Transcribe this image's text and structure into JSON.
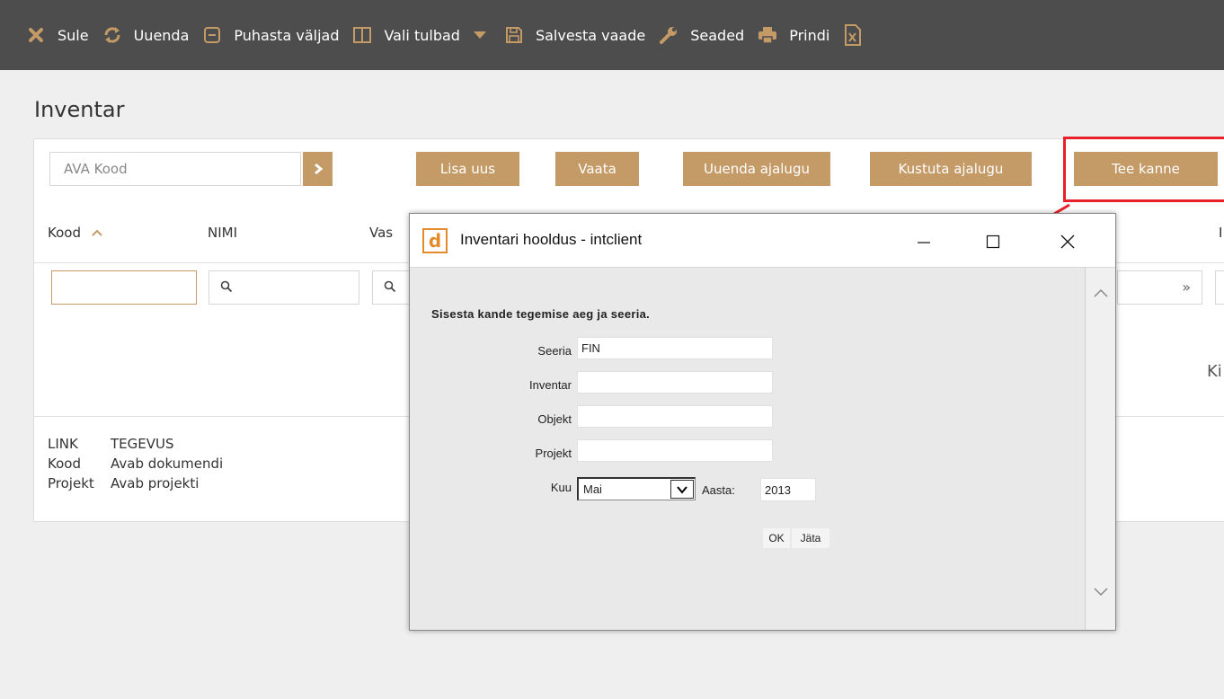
{
  "toolbar": {
    "items": [
      {
        "label": "Sule",
        "icon": "close-icon"
      },
      {
        "label": "Uuenda",
        "icon": "refresh-icon"
      },
      {
        "label": "Puhasta väljad",
        "icon": "clear-fields-icon"
      },
      {
        "label": "Vali tulbad",
        "icon": "columns-icon"
      },
      {
        "label": "Salvesta vaade",
        "icon": "save-icon"
      },
      {
        "label": "Seaded",
        "icon": "wrench-icon"
      },
      {
        "label": "Prindi",
        "icon": "print-icon"
      }
    ],
    "excel_icon": "excel-icon"
  },
  "page": {
    "title": "Inventar"
  },
  "search": {
    "placeholder": "AVA Kood"
  },
  "actions": {
    "add_new": "Lisa uus",
    "view": "Vaata",
    "update_history": "Uuenda ajalugu",
    "delete_history": "Kustuta ajalugu",
    "make_entry": "Tee kanne"
  },
  "table": {
    "columns": [
      "Kood",
      "NIMI",
      "Vas"
    ],
    "column_far_right": "I",
    "right_partial_text": "Ki",
    "pager_icon": "»"
  },
  "legend": {
    "header": {
      "key": "LINK",
      "value": "TEGEVUS"
    },
    "rows": [
      {
        "key": "Kood",
        "value": "Avab dokumendi"
      },
      {
        "key": "Projekt",
        "value": "Avab projekti"
      }
    ]
  },
  "dialog": {
    "title": "Inventari hooldus - intclient",
    "logo_letter": "d",
    "instruction": "Sisesta kande tegemise aeg ja seeria.",
    "fields": {
      "seeria_label": "Seeria",
      "seeria_value": "FIN",
      "inventar_label": "Inventar",
      "inventar_value": "",
      "objekt_label": "Objekt",
      "objekt_value": "",
      "projekt_label": "Projekt",
      "projekt_value": "",
      "kuu_label": "Kuu",
      "kuu_value": "Mai",
      "aasta_label": "Aasta:",
      "aasta_value": "2013"
    },
    "ok_label": "OK",
    "cancel_label": "Jäta"
  },
  "colors": {
    "accent": "#c49a67",
    "toolbar_bg": "#4d4d4d",
    "highlight": "#e8202a"
  }
}
